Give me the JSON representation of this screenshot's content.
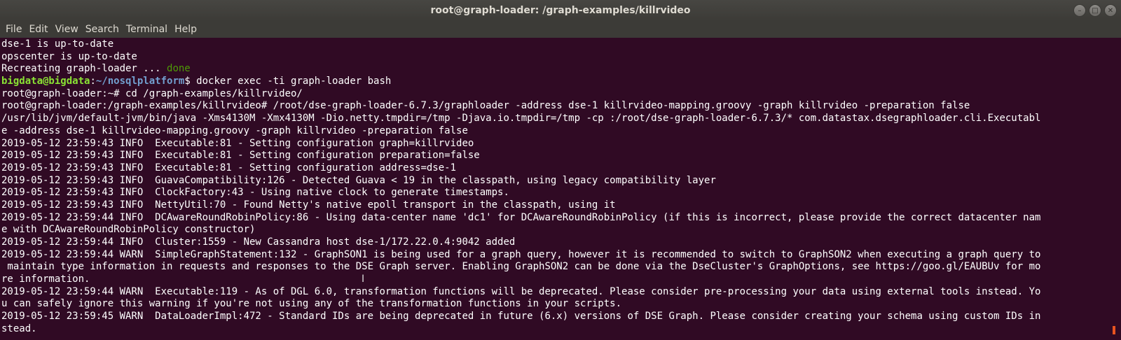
{
  "window": {
    "title": "root@graph-loader: /graph-examples/killrvideo",
    "controls": [
      "minimize-icon",
      "maximize-icon",
      "close-icon"
    ]
  },
  "menu": [
    "File",
    "Edit",
    "View",
    "Search",
    "Terminal",
    "Help"
  ],
  "terminal": {
    "line1": "dse-1 is up-to-date",
    "line2": "opscenter is up-to-date",
    "line3_text": "Recreating graph-loader ... ",
    "line3_status": "done",
    "prompt_user": "bigdata@bigdata",
    "prompt_path": "~/nosqlplatform",
    "prompt_cmd": "$ docker exec -ti graph-loader bash",
    "line5": "root@graph-loader:~# cd /graph-examples/killrvideo/",
    "line6": "root@graph-loader:/graph-examples/killrvideo# /root/dse-graph-loader-6.7.3/graphloader -address dse-1 killrvideo-mapping.groovy -graph killrvideo -preparation false",
    "line7": "/usr/lib/jvm/default-jvm/bin/java -Xms4130M -Xmx4130M -Dio.netty.tmpdir=/tmp -Djava.io.tmpdir=/tmp -cp :/root/dse-graph-loader-6.7.3/* com.datastax.dsegraphloader.cli.Executabl",
    "line8": "e -address dse-1 killrvideo-mapping.groovy -graph killrvideo -preparation false",
    "line9": "2019-05-12 23:59:43 INFO  Executable:81 - Setting configuration graph=killrvideo",
    "line10": "2019-05-12 23:59:43 INFO  Executable:81 - Setting configuration preparation=false",
    "line11": "2019-05-12 23:59:43 INFO  Executable:81 - Setting configuration address=dse-1",
    "line12": "2019-05-12 23:59:43 INFO  GuavaCompatibility:126 - Detected Guava < 19 in the classpath, using legacy compatibility layer",
    "line13": "2019-05-12 23:59:43 INFO  ClockFactory:43 - Using native clock to generate timestamps.",
    "line14": "2019-05-12 23:59:43 INFO  NettyUtil:70 - Found Netty's native epoll transport in the classpath, using it",
    "line15": "2019-05-12 23:59:44 INFO  DCAwareRoundRobinPolicy:86 - Using data-center name 'dc1' for DCAwareRoundRobinPolicy (if this is incorrect, please provide the correct datacenter nam",
    "line16": "e with DCAwareRoundRobinPolicy constructor)",
    "line17": "2019-05-12 23:59:44 INFO  Cluster:1559 - New Cassandra host dse-1/172.22.0.4:9042 added",
    "line18": "2019-05-12 23:59:44 WARN  SimpleGraphStatement:132 - GraphSON1 is being used for a graph query, however it is recommended to switch to GraphSON2 when executing a graph query to",
    "line19": " maintain type information in requests and responses to the DSE Graph server. Enabling GraphSON2 can be done via the DseCluster's GraphOptions, see https://goo.gl/EAUBUv for mo",
    "line20": "re information.",
    "line21": "2019-05-12 23:59:44 WARN  Executable:119 - As of DGL 6.0, transformation functions will be deprecated. Please consider pre-processing your data using external tools instead. Yo",
    "line22": "u can safely ignore this warning if you're not using any of the transformation functions in your scripts.",
    "line23": "2019-05-12 23:59:45 WARN  DataLoaderImpl:472 - Standard IDs are being deprecated in future (6.x) versions of DSE Graph. Please consider creating your schema using custom IDs in",
    "line24": "stead."
  },
  "colors": {
    "terminal_bg": "#300a24",
    "prompt_user": "#8ae234",
    "prompt_path": "#729fcf",
    "done": "#4e9a06"
  }
}
